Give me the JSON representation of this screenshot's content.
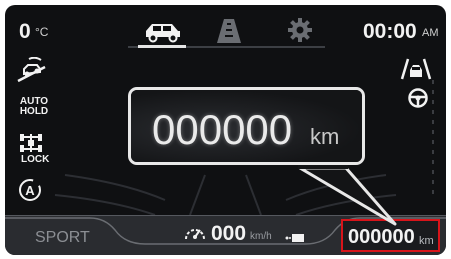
{
  "status": {
    "temperature": "0",
    "temperature_unit": "°C",
    "time": "00:00",
    "time_period": "AM"
  },
  "tabs": [
    {
      "icon": "car-icon",
      "active": true
    },
    {
      "icon": "road-lanes-icon",
      "active": false
    },
    {
      "icon": "gear-icon",
      "active": false
    }
  ],
  "left_indicators": {
    "hill_descent_icon": "hill-descent-icon",
    "auto_hold": "AUTO\nHOLD",
    "lock_label": "LOCK",
    "auto_stop_icon": "A"
  },
  "right_indicators": [
    "lane-assist-icon",
    "steering-wheel-icon"
  ],
  "popup": {
    "value": "000000",
    "unit": "km"
  },
  "bottom_bar": {
    "drive_mode": "SPORT",
    "speed": "000",
    "speed_unit": "km/h",
    "odometer": "000000",
    "odometer_unit": "km"
  },
  "colors": {
    "highlight": "#d8141a",
    "background": "#0f1012",
    "text": "#f2f2f2"
  }
}
